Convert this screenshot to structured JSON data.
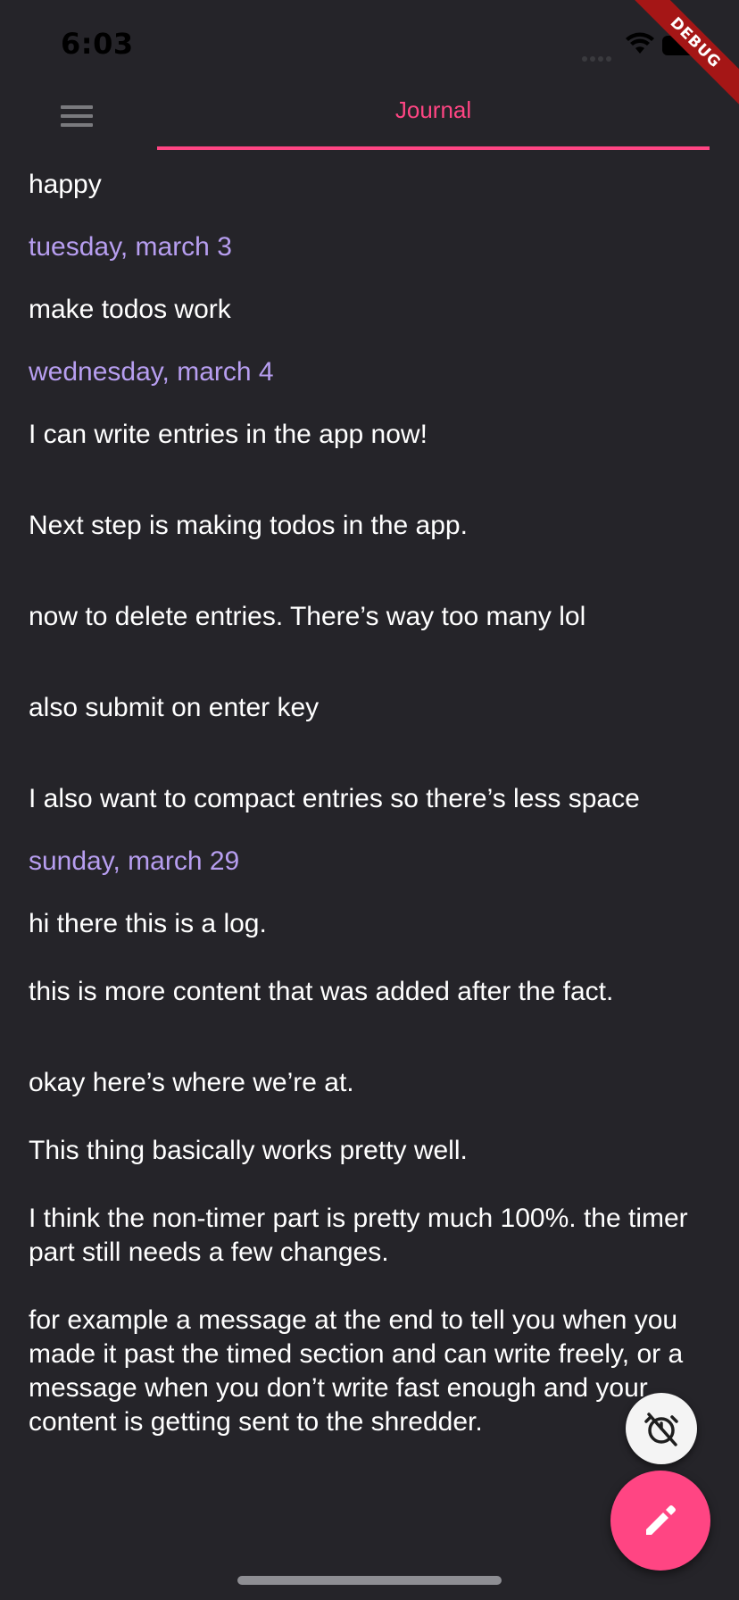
{
  "status_bar": {
    "time": "6:03"
  },
  "debug_banner": {
    "label": "DEBUG"
  },
  "app_bar": {
    "menu_icon": "hamburger-menu-icon",
    "tab_label": "Journal"
  },
  "colors": {
    "background": "#252429",
    "accent": "#ff4583",
    "date_heading": "#b79ef0",
    "text": "#ffffff"
  },
  "journal": {
    "entry_0": "happy",
    "date_1": "tuesday, march 3",
    "entry_1": "make todos work",
    "date_2": "wednesday, march 4",
    "entry_2a": "I can write entries in the app now!",
    "entry_2b": "Next step is making todos in the app.",
    "entry_2c": "now to delete entries. There’s way too many lol",
    "entry_2d": "also submit on enter key",
    "entry_2e": "I also want to compact entries so there’s less space",
    "date_3": "sunday, march 29",
    "entry_3a": "hi there this is a log.",
    "entry_3b": "this is more content that was added after the fact.",
    "entry_3c": "okay here’s where we’re at.",
    "entry_3d": "This thing basically works pretty well.",
    "entry_3e": "I think the non-timer part is pretty much 100%. the timer part still needs a few changes.",
    "entry_3f": "for example a message at the end to tell you when you made it past the timed section and can write freely, or a message when you don’t write fast enough and your content is getting sent to the shredder."
  },
  "fab": {
    "timer_icon": "timer-off-icon",
    "edit_icon": "pencil-edit-icon"
  }
}
